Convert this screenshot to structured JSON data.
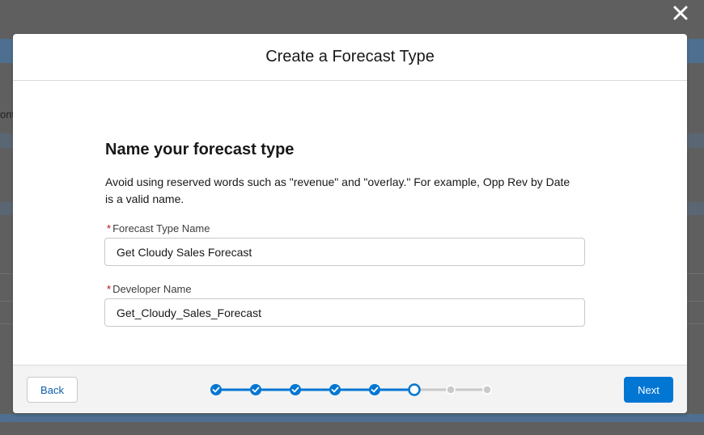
{
  "colors": {
    "overlay": "#5f5f5f",
    "brand": "#0176d3",
    "link": "#0b5cab",
    "required": "#ba0517",
    "step_incomplete": "#c9c9c9"
  },
  "background_page": {
    "text_fragment": "ont"
  },
  "close_button": {
    "icon": "close-icon"
  },
  "modal": {
    "title": "Create a Forecast Type",
    "section_title": "Name your forecast type",
    "instructions_line1": "Avoid using reserved words such as \"revenue\" and \"overlay.\" For example, Opp Rev by Date",
    "instructions_line2": "is a valid name.",
    "fields": {
      "forecast_type_name": {
        "required_marker": "*",
        "label": "Forecast Type Name",
        "value": "Get Cloudy Sales Forecast"
      },
      "developer_name": {
        "required_marker": "*",
        "label": "Developer Name",
        "value": "Get_Cloudy_Sales_Forecast"
      }
    },
    "footer": {
      "back_label": "Back",
      "next_label": "Next",
      "progress": {
        "total_steps": 8,
        "completed_steps": 5,
        "current_step": 6
      }
    }
  }
}
